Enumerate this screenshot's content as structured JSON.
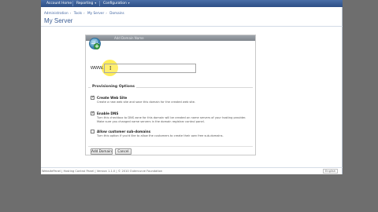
{
  "nav": {
    "items": [
      {
        "label": "Account Home",
        "has_menu": false
      },
      {
        "label": "Reporting",
        "has_menu": true
      },
      {
        "label": "Configuration",
        "has_menu": true
      }
    ],
    "caret": "▾"
  },
  "breadcrumb": {
    "items": [
      "Administration",
      "Tools",
      "My Server",
      "Domains"
    ],
    "separator": "›"
  },
  "page_title": "My Server",
  "dialog": {
    "title": "Add Domain Name",
    "www_label": "www.",
    "domain_value": "",
    "cursor": "I",
    "section_title": "Provisioning Options",
    "options": [
      {
        "title": "Create Web Site",
        "checked": true,
        "desc": "Create a new web site and save this domain for the created web site."
      },
      {
        "title": "Enable DNS",
        "checked": true,
        "desc": "Turn this checkbox to DNS zone for this domain will be created on name servers of your hosting provider. Make sure you changed name servers in the domain registrar control panel."
      },
      {
        "title": "Allow customer sub-domains",
        "checked": false,
        "desc": "Turn this option if you'd like to allow the customers to create their own free sub-domains."
      }
    ],
    "buttons": {
      "add": "Add Domain",
      "cancel": "Cancel"
    }
  },
  "footer": {
    "text": "WebsitePanel  |  Hosting Control Panel  |  Version 1.1.0  |  © 2010 Outercurve Foundation",
    "right": "English"
  },
  "colors": {
    "nav": "#2d4f86",
    "accent": "#3a5c94",
    "highlight": "#ffea3c",
    "add_icon": "#3ea74a"
  },
  "icons": {
    "globe": "globe-add-icon"
  }
}
